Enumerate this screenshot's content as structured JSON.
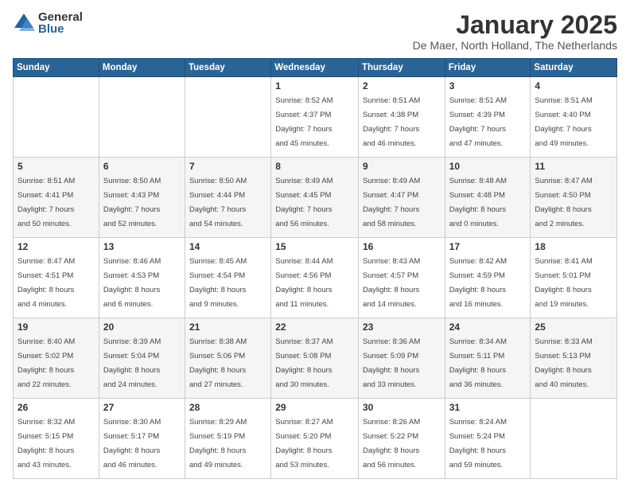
{
  "logo": {
    "general": "General",
    "blue": "Blue"
  },
  "title": "January 2025",
  "subtitle": "De Maer, North Holland, The Netherlands",
  "weekdays": [
    "Sunday",
    "Monday",
    "Tuesday",
    "Wednesday",
    "Thursday",
    "Friday",
    "Saturday"
  ],
  "weeks": [
    [
      {
        "day": "",
        "info": ""
      },
      {
        "day": "",
        "info": ""
      },
      {
        "day": "",
        "info": ""
      },
      {
        "day": "1",
        "info": "Sunrise: 8:52 AM\nSunset: 4:37 PM\nDaylight: 7 hours\nand 45 minutes."
      },
      {
        "day": "2",
        "info": "Sunrise: 8:51 AM\nSunset: 4:38 PM\nDaylight: 7 hours\nand 46 minutes."
      },
      {
        "day": "3",
        "info": "Sunrise: 8:51 AM\nSunset: 4:39 PM\nDaylight: 7 hours\nand 47 minutes."
      },
      {
        "day": "4",
        "info": "Sunrise: 8:51 AM\nSunset: 4:40 PM\nDaylight: 7 hours\nand 49 minutes."
      }
    ],
    [
      {
        "day": "5",
        "info": "Sunrise: 8:51 AM\nSunset: 4:41 PM\nDaylight: 7 hours\nand 50 minutes."
      },
      {
        "day": "6",
        "info": "Sunrise: 8:50 AM\nSunset: 4:43 PM\nDaylight: 7 hours\nand 52 minutes."
      },
      {
        "day": "7",
        "info": "Sunrise: 8:50 AM\nSunset: 4:44 PM\nDaylight: 7 hours\nand 54 minutes."
      },
      {
        "day": "8",
        "info": "Sunrise: 8:49 AM\nSunset: 4:45 PM\nDaylight: 7 hours\nand 56 minutes."
      },
      {
        "day": "9",
        "info": "Sunrise: 8:49 AM\nSunset: 4:47 PM\nDaylight: 7 hours\nand 58 minutes."
      },
      {
        "day": "10",
        "info": "Sunrise: 8:48 AM\nSunset: 4:48 PM\nDaylight: 8 hours\nand 0 minutes."
      },
      {
        "day": "11",
        "info": "Sunrise: 8:47 AM\nSunset: 4:50 PM\nDaylight: 8 hours\nand 2 minutes."
      }
    ],
    [
      {
        "day": "12",
        "info": "Sunrise: 8:47 AM\nSunset: 4:51 PM\nDaylight: 8 hours\nand 4 minutes."
      },
      {
        "day": "13",
        "info": "Sunrise: 8:46 AM\nSunset: 4:53 PM\nDaylight: 8 hours\nand 6 minutes."
      },
      {
        "day": "14",
        "info": "Sunrise: 8:45 AM\nSunset: 4:54 PM\nDaylight: 8 hours\nand 9 minutes."
      },
      {
        "day": "15",
        "info": "Sunrise: 8:44 AM\nSunset: 4:56 PM\nDaylight: 8 hours\nand 11 minutes."
      },
      {
        "day": "16",
        "info": "Sunrise: 8:43 AM\nSunset: 4:57 PM\nDaylight: 8 hours\nand 14 minutes."
      },
      {
        "day": "17",
        "info": "Sunrise: 8:42 AM\nSunset: 4:59 PM\nDaylight: 8 hours\nand 16 minutes."
      },
      {
        "day": "18",
        "info": "Sunrise: 8:41 AM\nSunset: 5:01 PM\nDaylight: 8 hours\nand 19 minutes."
      }
    ],
    [
      {
        "day": "19",
        "info": "Sunrise: 8:40 AM\nSunset: 5:02 PM\nDaylight: 8 hours\nand 22 minutes."
      },
      {
        "day": "20",
        "info": "Sunrise: 8:39 AM\nSunset: 5:04 PM\nDaylight: 8 hours\nand 24 minutes."
      },
      {
        "day": "21",
        "info": "Sunrise: 8:38 AM\nSunset: 5:06 PM\nDaylight: 8 hours\nand 27 minutes."
      },
      {
        "day": "22",
        "info": "Sunrise: 8:37 AM\nSunset: 5:08 PM\nDaylight: 8 hours\nand 30 minutes."
      },
      {
        "day": "23",
        "info": "Sunrise: 8:36 AM\nSunset: 5:09 PM\nDaylight: 8 hours\nand 33 minutes."
      },
      {
        "day": "24",
        "info": "Sunrise: 8:34 AM\nSunset: 5:11 PM\nDaylight: 8 hours\nand 36 minutes."
      },
      {
        "day": "25",
        "info": "Sunrise: 8:33 AM\nSunset: 5:13 PM\nDaylight: 8 hours\nand 40 minutes."
      }
    ],
    [
      {
        "day": "26",
        "info": "Sunrise: 8:32 AM\nSunset: 5:15 PM\nDaylight: 8 hours\nand 43 minutes."
      },
      {
        "day": "27",
        "info": "Sunrise: 8:30 AM\nSunset: 5:17 PM\nDaylight: 8 hours\nand 46 minutes."
      },
      {
        "day": "28",
        "info": "Sunrise: 8:29 AM\nSunset: 5:19 PM\nDaylight: 8 hours\nand 49 minutes."
      },
      {
        "day": "29",
        "info": "Sunrise: 8:27 AM\nSunset: 5:20 PM\nDaylight: 8 hours\nand 53 minutes."
      },
      {
        "day": "30",
        "info": "Sunrise: 8:26 AM\nSunset: 5:22 PM\nDaylight: 8 hours\nand 56 minutes."
      },
      {
        "day": "31",
        "info": "Sunrise: 8:24 AM\nSunset: 5:24 PM\nDaylight: 8 hours\nand 59 minutes."
      },
      {
        "day": "",
        "info": ""
      }
    ]
  ]
}
